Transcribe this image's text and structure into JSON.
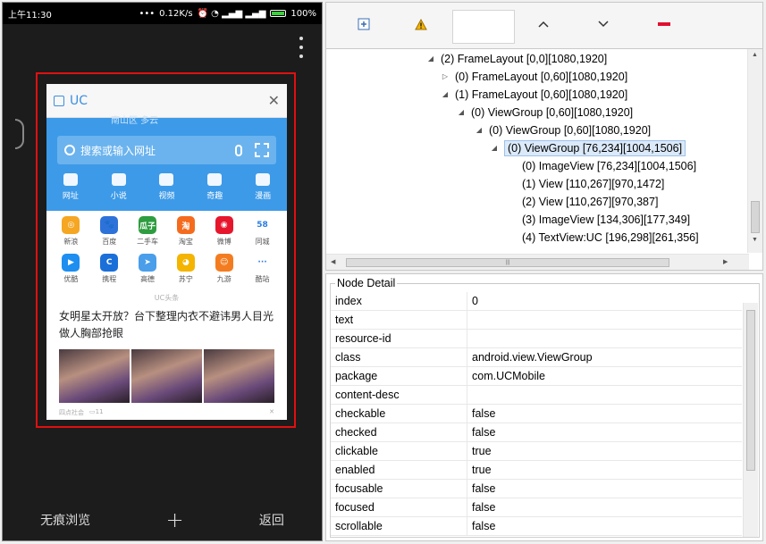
{
  "phone": {
    "status": {
      "time": "上午11:30",
      "speed": "0.12K/s",
      "battery": "100%"
    },
    "card": {
      "title": "UC",
      "cutoff_text": "南山区 多云",
      "search_placeholder": "搜索或输入网址",
      "tabs": [
        "网址",
        "小说",
        "视频",
        "奇趣",
        "漫画"
      ],
      "apps": [
        {
          "label": "新浪",
          "color": "#f5a623",
          "glyph": "◎"
        },
        {
          "label": "百度",
          "color": "#2d72d9",
          "glyph": "🐾"
        },
        {
          "label": "二手车",
          "color": "#2e9d3f",
          "glyph": "瓜子"
        },
        {
          "label": "淘宝",
          "color": "#f56b1e",
          "glyph": "淘"
        },
        {
          "label": "微博",
          "color": "#e6162d",
          "glyph": "◉"
        },
        {
          "label": "同城",
          "color": "#ffffff",
          "glyph": "58"
        },
        {
          "label": "优酷",
          "color": "#1e8ef0",
          "glyph": "▶"
        },
        {
          "label": "携程",
          "color": "#1b6fd8",
          "glyph": "C"
        },
        {
          "label": "高德",
          "color": "#4a9eea",
          "glyph": "➤"
        },
        {
          "label": "苏宁",
          "color": "#f4b400",
          "glyph": "◕"
        },
        {
          "label": "九游",
          "color": "#f47c20",
          "glyph": "☺"
        },
        {
          "label": "酷站",
          "color": "#ffffff",
          "glyph": "···"
        }
      ],
      "feed_label": "UC头条",
      "headline": "女明星太开放？台下整理内衣不避讳男人目光做人胸部抢眼",
      "news_source": "四点社会",
      "news_comments": "11"
    },
    "bottom": {
      "private": "无痕浏览",
      "plus": "+",
      "back": "返回"
    }
  },
  "toolbar": {
    "icons": [
      "expand-icon",
      "warning-icon",
      "up-arrow-icon",
      "down-arrow-icon",
      "minus-icon"
    ],
    "input_value": ""
  },
  "tree": {
    "rows": [
      {
        "toggle": "◢",
        "label": "(2) FrameLayout [0,0][1080,1920]"
      },
      {
        "toggle": "▷",
        "label": "(0) FrameLayout [0,60][1080,1920]"
      },
      {
        "toggle": "◢",
        "label": "(1) FrameLayout [0,60][1080,1920]"
      },
      {
        "toggle": "◢",
        "label": "(0) ViewGroup [0,60][1080,1920]"
      },
      {
        "toggle": "◢",
        "label": "(0) ViewGroup [0,60][1080,1920]"
      },
      {
        "toggle": "◢",
        "label": "(0) ViewGroup [76,234][1004,1506]",
        "selected": true
      },
      {
        "toggle": "",
        "label": "(0) ImageView [76,234][1004,1506]"
      },
      {
        "toggle": "",
        "label": "(1) View [110,267][970,1472]"
      },
      {
        "toggle": "",
        "label": "(2) View [110,267][970,387]"
      },
      {
        "toggle": "",
        "label": "(3) ImageView [134,306][177,349]"
      },
      {
        "toggle": "",
        "label": "(4) TextView:UC [196,298][261,356]"
      }
    ]
  },
  "detail": {
    "title": "Node Detail",
    "props": [
      {
        "key": "index",
        "value": "0"
      },
      {
        "key": "text",
        "value": ""
      },
      {
        "key": "resource-id",
        "value": ""
      },
      {
        "key": "class",
        "value": "android.view.ViewGroup"
      },
      {
        "key": "package",
        "value": "com.UCMobile"
      },
      {
        "key": "content-desc",
        "value": ""
      },
      {
        "key": "checkable",
        "value": "false"
      },
      {
        "key": "checked",
        "value": "false"
      },
      {
        "key": "clickable",
        "value": "true"
      },
      {
        "key": "enabled",
        "value": "true"
      },
      {
        "key": "focusable",
        "value": "false"
      },
      {
        "key": "focused",
        "value": "false"
      },
      {
        "key": "scrollable",
        "value": "false"
      }
    ]
  },
  "colors": {
    "selection_red": "#e01010",
    "uc_blue": "#3d9ae8"
  }
}
